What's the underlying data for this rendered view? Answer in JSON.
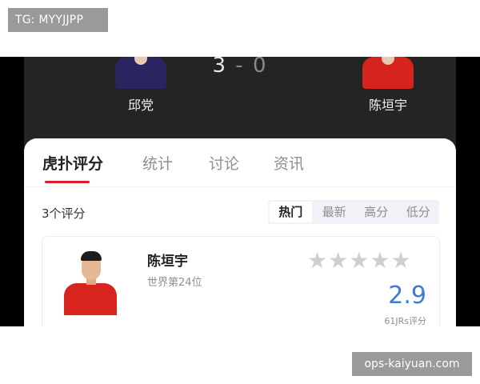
{
  "watermarks": {
    "top": "TG: MYYJJPP",
    "bottom": "ops-kaiyuan.com"
  },
  "match": {
    "score_left": "3",
    "score_sep": "-",
    "score_right": "0",
    "player_left": "邱党",
    "player_right": "陈垣宇"
  },
  "tabs": [
    {
      "label": "虎扑评分",
      "active": true
    },
    {
      "label": "统计"
    },
    {
      "label": "讨论"
    },
    {
      "label": "资讯"
    }
  ],
  "ratings": {
    "count_label": "3个评分",
    "sort_options": [
      "热门",
      "最新",
      "高分",
      "低分"
    ],
    "active_sort": "热门"
  },
  "card": {
    "name": "陈垣宇",
    "rank": "世界第24位",
    "stars": 5,
    "star_glyph": "★",
    "score": "2.9",
    "votes": "61JRs评分"
  },
  "colors": {
    "accent_red": "#d6202a",
    "score_blue": "#3d7bd6",
    "dark_bg": "#242424"
  }
}
